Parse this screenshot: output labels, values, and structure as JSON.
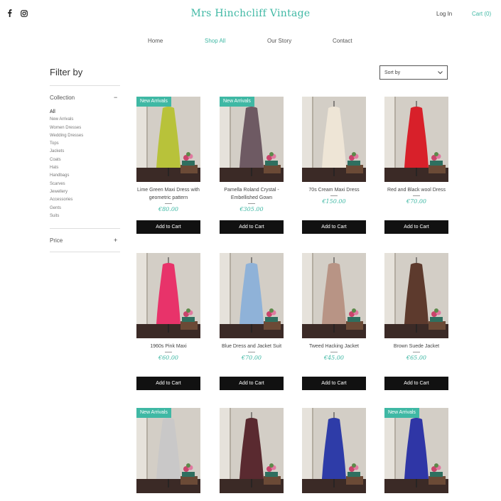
{
  "header": {
    "brand": "Mrs Hinchcliff Vintage",
    "login_label": "Log In",
    "cart_label": "Cart (0)",
    "social_icons": [
      "facebook-icon",
      "instagram-icon"
    ]
  },
  "nav": [
    {
      "label": "Home",
      "active": false
    },
    {
      "label": "Shop All",
      "active": true
    },
    {
      "label": "Our Story",
      "active": false
    },
    {
      "label": "Contact",
      "active": false
    }
  ],
  "filter": {
    "title": "Filter by",
    "collection_label": "Collection",
    "collection_toggle": "−",
    "collection_items": [
      "All",
      "New Arrivals",
      "Women Dresses",
      "Wedding Dresses",
      "Tops",
      "Jackets",
      "Coats",
      "Hats",
      "Handbags",
      "Scarves",
      "Jewellery",
      "Accessories",
      "Gents",
      "Suits"
    ],
    "selected_collection": "All",
    "price_label": "Price",
    "price_toggle": "+"
  },
  "sort": {
    "label": "Sort by"
  },
  "colors": {
    "accent": "#3fb8a4",
    "button_bg": "#111111"
  },
  "add_to_cart_label": "Add to Cart",
  "products": [
    {
      "name": "Lime Green Maxi Dress with geometric pattern",
      "price": "€80.00",
      "badge": "New Arrivals",
      "garment_color": "#b8c23a"
    },
    {
      "name": "Pamella Roland Crystal - Embellished Gown",
      "price": "€305.00",
      "badge": "New Arrivals",
      "garment_color": "#6e5a63"
    },
    {
      "name": "70s Cream Maxi Dress",
      "price": "€150.00",
      "badge": "",
      "garment_color": "#eee5d6"
    },
    {
      "name": "Red and Black wool Dress",
      "price": "€70.00",
      "badge": "",
      "garment_color": "#d8202a"
    },
    {
      "name": "1960s Pink Maxi",
      "price": "€60.00",
      "badge": "",
      "garment_color": "#e8336a"
    },
    {
      "name": "Blue Dress and Jacket Suit",
      "price": "€70.00",
      "badge": "",
      "garment_color": "#8fb2d8"
    },
    {
      "name": "Tweed Hacking Jacket",
      "price": "€45.00",
      "badge": "",
      "garment_color": "#b89485"
    },
    {
      "name": "Brown Suede Jacket",
      "price": "€65.00",
      "badge": "",
      "garment_color": "#5d3a2d"
    },
    {
      "name": "",
      "price": "",
      "badge": "New Arrivals",
      "garment_color": "#c9c8c8"
    },
    {
      "name": "",
      "price": "",
      "badge": "",
      "garment_color": "#5a2a30"
    },
    {
      "name": "",
      "price": "",
      "badge": "",
      "garment_color": "#2e3ca8"
    },
    {
      "name": "",
      "price": "",
      "badge": "New Arrivals",
      "garment_color": "#2f36a6"
    }
  ]
}
